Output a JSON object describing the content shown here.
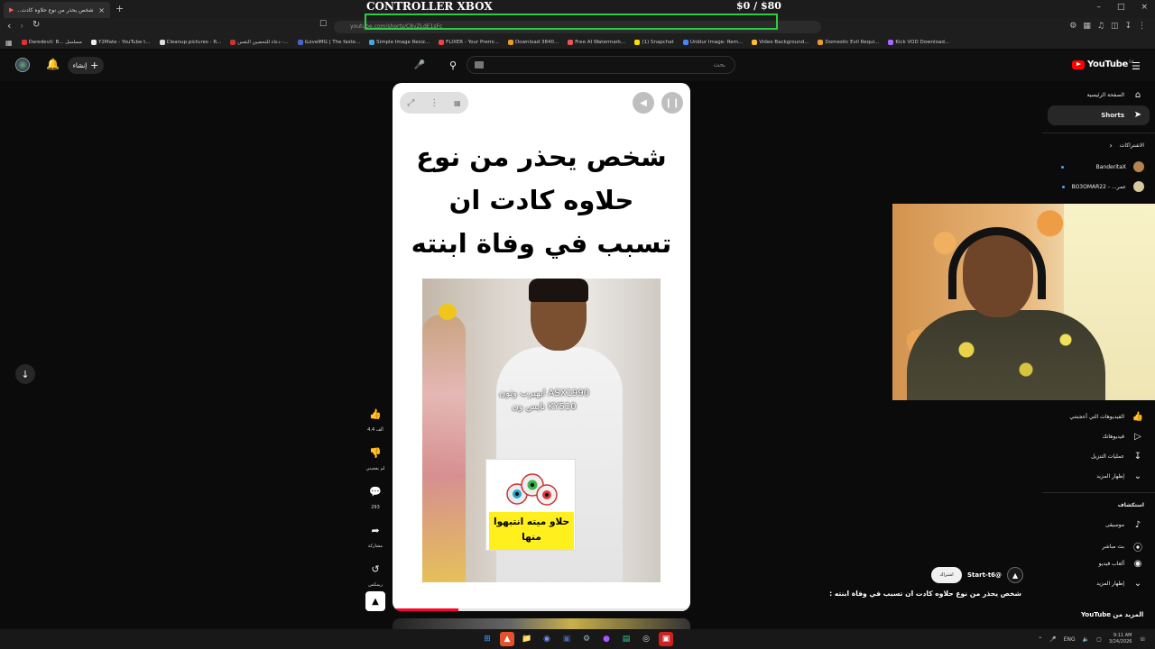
{
  "browser": {
    "tab_title": "شخص يحذر من نوع حلاوه كادت...",
    "url": "youtube.com/shorts/C8vZLdE1sFc",
    "bookmarks": [
      {
        "label": "Daredevil: B... مسلسل",
        "color": "#d33"
      },
      {
        "label": "Y2Mate - YouTube t...",
        "color": "#eee"
      },
      {
        "label": "Cleanup.pictures - R...",
        "color": "#ddd"
      },
      {
        "label": "دعاء للتحصين النفس -...",
        "color": "#c33"
      },
      {
        "label": "iLoveIMG | The faste...",
        "color": "#46c"
      },
      {
        "label": "Simple Image Resiz...",
        "color": "#4ad"
      },
      {
        "label": "FLIXER - Your Premi...",
        "color": "#e44"
      },
      {
        "label": "Download 3840...",
        "color": "#e92"
      },
      {
        "label": "Free AI Watermark...",
        "color": "#e55"
      },
      {
        "label": "(1) Snapchat",
        "color": "#fd0"
      },
      {
        "label": "Unblur Image: Rem...",
        "color": "#48f"
      },
      {
        "label": "Video Background...",
        "color": "#fb3"
      },
      {
        "label": "Domestic Evil Requi...",
        "color": "#e93"
      },
      {
        "label": "Kick VOD Download...",
        "color": "#a6f"
      }
    ]
  },
  "overlay": {
    "title": "CONTROLLER XBOX",
    "cost": "$0 / $80"
  },
  "header": {
    "create_label": "إنشاء",
    "search_placeholder": "بحث",
    "logo_text": "YouTube",
    "region": "SA"
  },
  "short": {
    "headline": "شخص يحذر من نوع حلاوه كادت ان تسبب في وفاة ابنته :",
    "video_caption_line1": "ايهيرب وتون  ASX1990",
    "video_caption_line2": "نايس ون  KY510",
    "card_text": "حلاو ميته انتبهوا منها",
    "progress": 0.22
  },
  "actions": {
    "likes": "4.4 ألف",
    "dislike_label": "لم يعجبني",
    "comments": "293",
    "share_label": "مشاركة",
    "remix_label": "ريمكس"
  },
  "sidebar": {
    "home": "الصفحة الرئيسية",
    "shorts": "Shorts",
    "subscriptions": "الاشتراكات",
    "subs": [
      {
        "name": "BanderitaX",
        "color": "#b58450"
      },
      {
        "name": "BO3OMAR22 - ...عمر",
        "color": "#d7c9a0"
      }
    ],
    "liked": "الفيديوهات التي أعجبتني",
    "your_videos": "فيديوهاتك",
    "downloads": "عمليات التنزيل",
    "show_more_1": "إظهار المزيد",
    "explore": "استكشاف",
    "music": "موسيقى",
    "live": "بث مباشر",
    "gaming": "ألعاب فيديو",
    "show_more_2": "إظهار المزيد"
  },
  "meta": {
    "channel_handle": "@Start-t6",
    "subscribe_label": "اشتراك",
    "title": "شخص يحذر من نوع حلاوه كادت ان تسبب في وفاة ابنته :",
    "more_from": "المزيد من YouTube"
  },
  "taskbar": {
    "lang": "ENG",
    "time": "9:11 AM",
    "date": "3/24/2026"
  },
  "colors": {
    "accent_red": "#ff0033",
    "overlay_green": "#2ecc40",
    "card_yellow": "#ffef1d"
  }
}
